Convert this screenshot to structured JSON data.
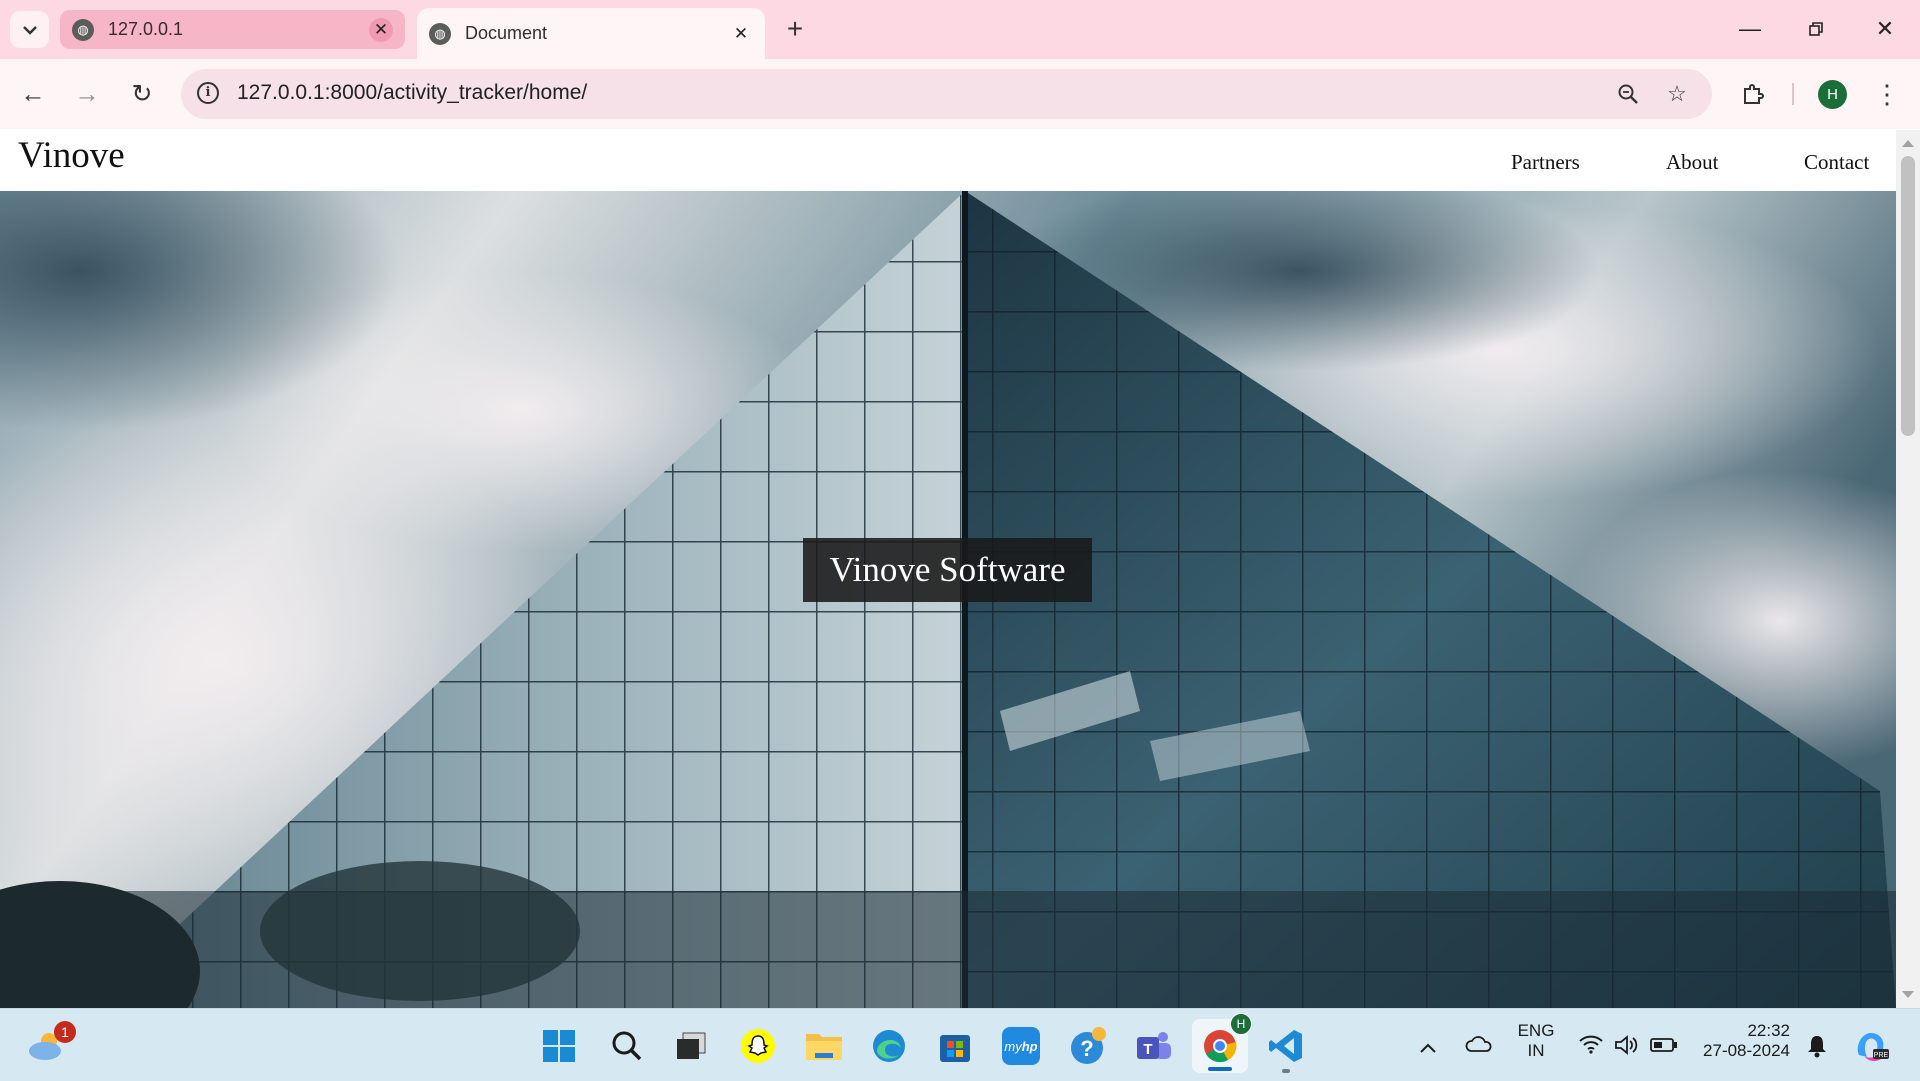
{
  "browser": {
    "tabs": [
      {
        "title": "127.0.0.1",
        "active": false
      },
      {
        "title": "Document",
        "active": true
      }
    ],
    "address": "127.0.0.1:8000/activity_tracker/home/",
    "profile_initial": "H"
  },
  "page": {
    "brand": "Vinove",
    "nav_links": [
      "Partners",
      "About",
      "Contact"
    ],
    "hero_title": "Vinove Software",
    "hero_image": "glass office building under cloudy sky"
  },
  "taskbar": {
    "weather_badge": "1",
    "chrome_badge": "H",
    "language_line1": "ENG",
    "language_line2": "IN",
    "time": "22:32",
    "date": "27-08-2024",
    "apps": [
      "start-icon",
      "search-icon",
      "task-view-icon",
      "snapchat-icon",
      "file-explorer-icon",
      "edge-icon",
      "store-icon",
      "myhp-icon",
      "help-icon",
      "teams-icon",
      "chrome-icon",
      "vscode-icon"
    ]
  },
  "colors": {
    "tabstrip": "#fcd9e3",
    "toolbar": "#fff5f7",
    "taskbar": "#d6e8f2",
    "hero_overlay": "#191919"
  }
}
